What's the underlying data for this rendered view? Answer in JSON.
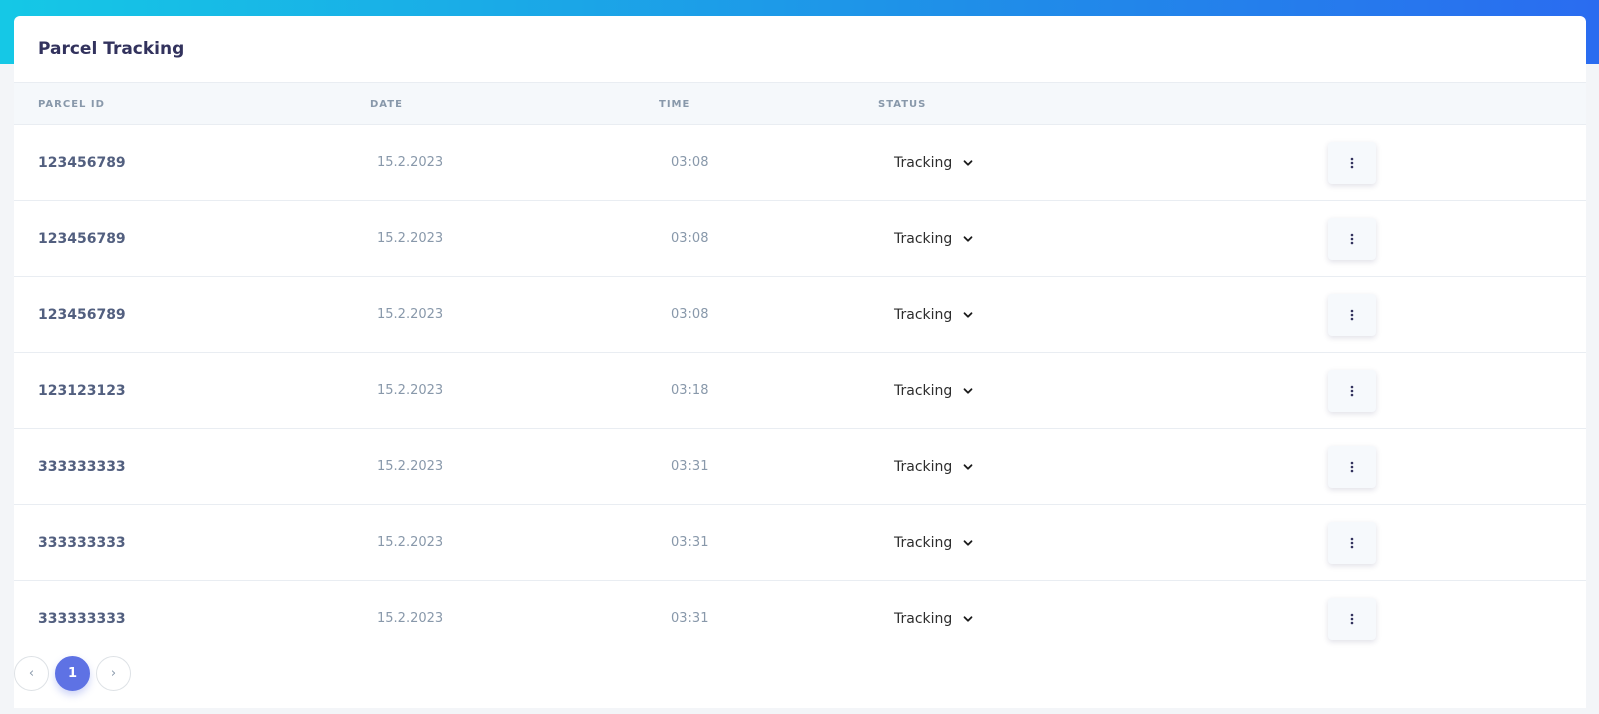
{
  "card": {
    "title": "Parcel Tracking"
  },
  "table": {
    "headers": [
      "PARCEL ID",
      "DATE",
      "TIME",
      "STATUS"
    ],
    "rows": [
      {
        "id": "123456789",
        "date": "15.2.2023",
        "time": "03:08",
        "status": "Tracking"
      },
      {
        "id": "123456789",
        "date": "15.2.2023",
        "time": "03:08",
        "status": "Tracking"
      },
      {
        "id": "123456789",
        "date": "15.2.2023",
        "time": "03:08",
        "status": "Tracking"
      },
      {
        "id": "123123123",
        "date": "15.2.2023",
        "time": "03:18",
        "status": "Tracking"
      },
      {
        "id": "333333333",
        "date": "15.2.2023",
        "time": "03:31",
        "status": "Tracking"
      },
      {
        "id": "333333333",
        "date": "15.2.2023",
        "time": "03:31",
        "status": "Tracking"
      },
      {
        "id": "333333333",
        "date": "15.2.2023",
        "time": "03:31",
        "status": "Tracking"
      }
    ]
  },
  "pagination": {
    "prev": "‹",
    "current": "1",
    "next": "›"
  },
  "colors": {
    "accent": "#5e72e4",
    "gradient_start": "#15c8e6",
    "gradient_end": "#2a6cf0"
  },
  "icons": {
    "status_dropdown": "chevron-down-icon",
    "row_menu": "more-vertical-icon"
  }
}
